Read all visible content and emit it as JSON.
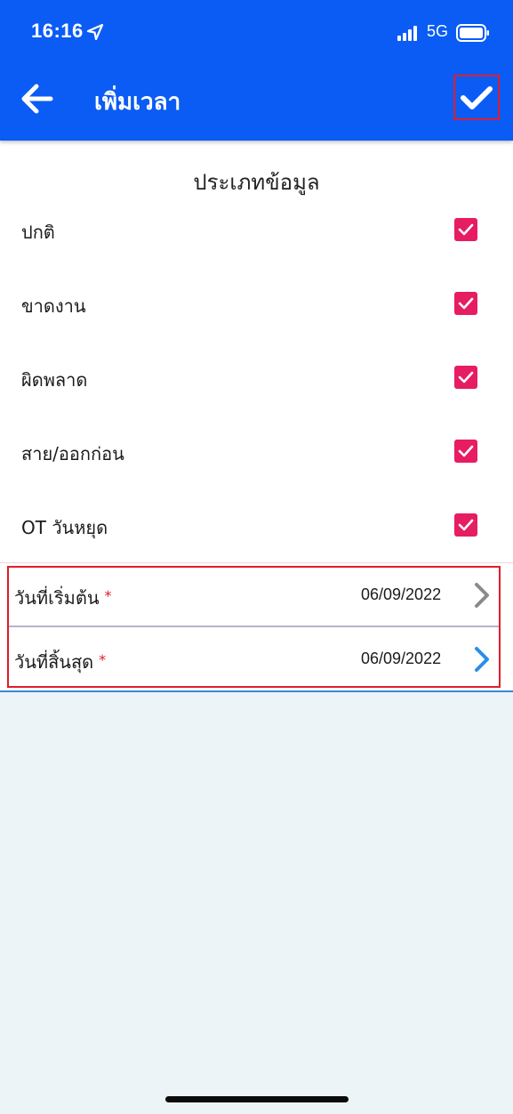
{
  "status_bar": {
    "time": "16:16",
    "network": "5G"
  },
  "header": {
    "title": "เพิ่มเวลา",
    "back_icon": "arrow-left-icon",
    "confirm_icon": "checkmark-icon",
    "background": "#0a5cf5"
  },
  "section": {
    "title": "ประเภทข้อมูล"
  },
  "types": [
    {
      "label": "ปกติ",
      "checked": true
    },
    {
      "label": "ขาดงาน",
      "checked": true
    },
    {
      "label": "ผิดพลาด",
      "checked": true
    },
    {
      "label": "สาย/ออกก่อน",
      "checked": true
    },
    {
      "label": "OT วันหยุด",
      "checked": true
    }
  ],
  "date_fields": {
    "start": {
      "label": "วันที่เริ่มต้น",
      "required_mark": "*",
      "value": "06/09/2022"
    },
    "end": {
      "label": "วันที่สิ้นสุด",
      "required_mark": "*",
      "value": "06/09/2022"
    }
  },
  "colors": {
    "checkbox": "#e61d62",
    "highlight": "#e01d2b",
    "chevron_start": "#8a8a8a",
    "chevron_end": "#2b8ee6"
  }
}
